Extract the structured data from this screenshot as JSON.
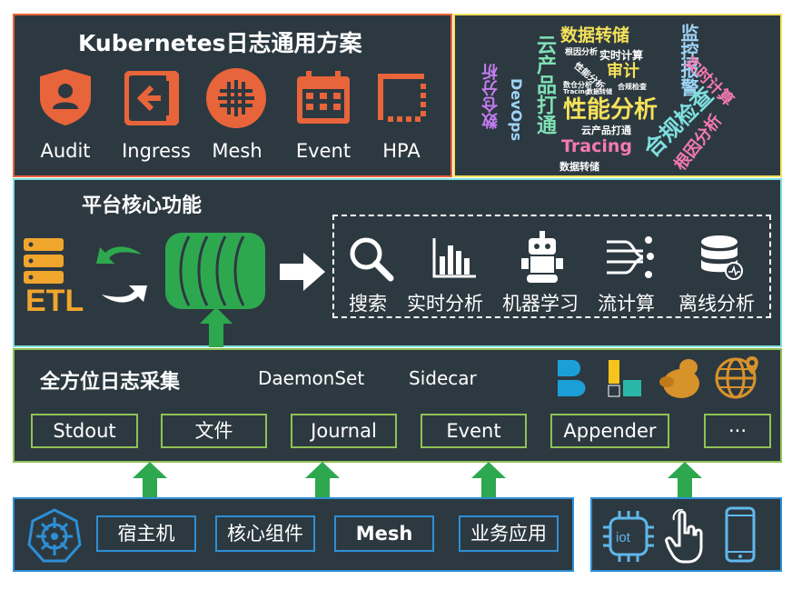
{
  "top": {
    "title": "Kubernetes日志通用方案",
    "icons": [
      {
        "label": "Audit",
        "icon": "shield-user-icon"
      },
      {
        "label": "Ingress",
        "icon": "login-arrow-icon"
      },
      {
        "label": "Mesh",
        "icon": "grid-mesh-icon"
      },
      {
        "label": "Event",
        "icon": "calendar-icon"
      },
      {
        "label": "HPA",
        "icon": "scale-corner-icon"
      }
    ]
  },
  "wordcloud": [
    "数据转储",
    "监控报警",
    "实时计算",
    "云产品打通",
    "数仓分析",
    "DevOps",
    "性能分析",
    "合规检查",
    "根因分析",
    "Tracing",
    "审计",
    "数据转储",
    "云产品打通",
    "根因分析",
    "实时计算",
    "性能分析",
    "合规检查",
    "数仓分析",
    "Tracing",
    "数据转储"
  ],
  "core": {
    "title": "平台核心功能",
    "features": [
      {
        "label": "搜索",
        "icon": "search-icon"
      },
      {
        "label": "实时分析",
        "icon": "bar-chart-icon"
      },
      {
        "label": "机器学习",
        "icon": "robot-icon"
      },
      {
        "label": "流计算",
        "icon": "stream-icon"
      },
      {
        "label": "离线分析",
        "icon": "database-icon"
      }
    ]
  },
  "collect": {
    "title": "全方位日志采集",
    "modes": [
      "DaemonSet",
      "Sidecar"
    ],
    "sources": [
      "Stdout",
      "文件",
      "Journal",
      "Event",
      "Appender",
      "···"
    ]
  },
  "bottom": {
    "k8s_items": [
      "宿主机",
      "核心组件",
      "Mesh",
      "业务应用"
    ],
    "device_icons": [
      "iot-chip-icon",
      "hand-pointer-icon",
      "mobile-phone-icon"
    ]
  },
  "colors": {
    "panel": "#2d3941",
    "orange": "#e8643a",
    "yellow": "#f5e15a",
    "cyan": "#7fe0e0",
    "green": "#8fc255",
    "blue": "#2d8fd6",
    "arrow_green": "#2ea84f"
  }
}
